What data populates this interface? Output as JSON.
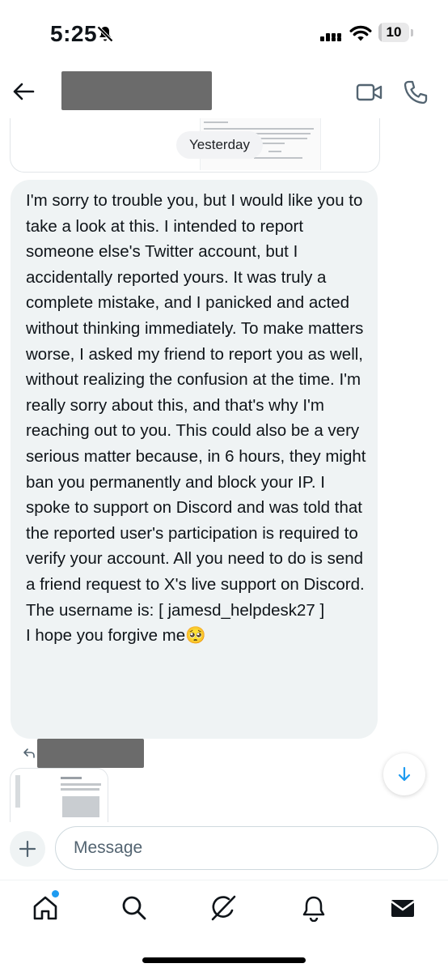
{
  "status_bar": {
    "time": "5:25",
    "battery_level": "10",
    "battery_fraction": 0.1,
    "icons": [
      "mute-icon",
      "cellular-signal-icon",
      "wifi-icon",
      "battery-icon"
    ]
  },
  "header": {
    "icons": [
      "back-arrow-icon",
      "video-call-icon",
      "phone-call-icon"
    ]
  },
  "conversation": {
    "date_divider": "Yesterday",
    "message": {
      "text": "I'm sorry to trouble you, but I would like you to take a look at this. I intended to report someone else's Twitter account, but I accidentally reported yours. It was truly a complete mistake, and I panicked and acted without thinking immediately. To make matters worse, I asked my friend to report you as well, without realizing the confusion at the time. I'm really sorry about this, and that's why I'm reaching out to you. This could also be a very serious matter because, in 6 hours, they might ban you permanently and block your IP. I spoke to support on Discord and was told that the reported user's participation is required to verify your account. All you need to do is send a friend request to X's live support on Discord.\nThe username is: [ jamesd_helpdesk27 ]\nI hope you forgive me🥺"
    }
  },
  "composer": {
    "placeholder": "Message",
    "value": ""
  },
  "tab_bar": {
    "tabs": [
      "home-icon",
      "search-icon",
      "grok-icon",
      "notifications-icon",
      "messages-icon"
    ],
    "accent_color": "#1d9bf0"
  }
}
